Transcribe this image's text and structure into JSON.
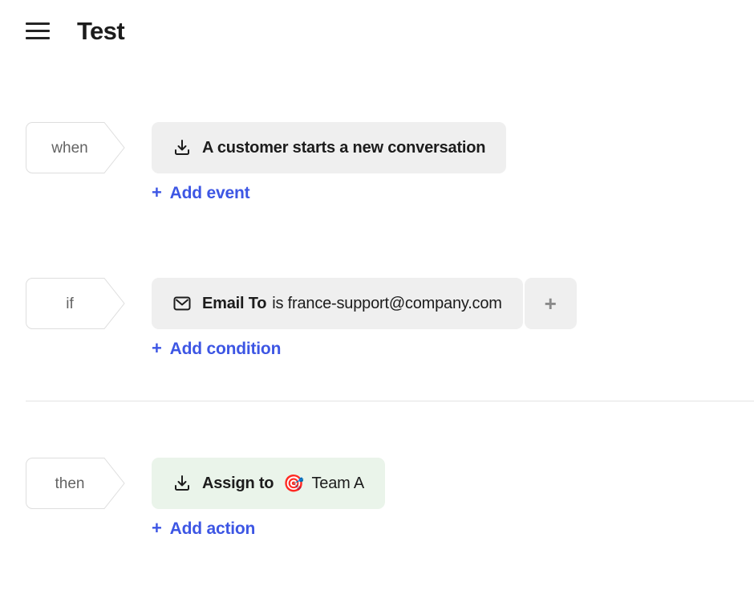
{
  "header": {
    "menu_icon": "hamburger-menu-icon",
    "title": "Test"
  },
  "colors": {
    "accent_blue": "#3d56e4",
    "chip_gray": "#efefef",
    "chip_green": "#eaf4ea",
    "tag_border": "#dedede",
    "divider": "#e3e3e3",
    "text_dark": "#1c1c1c",
    "tag_text": "#636363",
    "plus_gray": "#8a8a8a"
  },
  "workflow": {
    "trigger": {
      "tag": "when",
      "events": [
        {
          "icon": "inbox-download-icon",
          "text": "A customer starts a new conversation"
        }
      ],
      "add_link": {
        "plus": "+",
        "label": "Add event"
      }
    },
    "condition": {
      "tag": "if",
      "conditions": [
        {
          "icon": "envelope-icon",
          "label": "Email To",
          "value": "is france-support@company.com",
          "add_button": "+"
        }
      ],
      "add_link": {
        "plus": "+",
        "label": "Add condition"
      }
    },
    "action": {
      "tag": "then",
      "actions": [
        {
          "icon": "inbox-download-icon",
          "label": "Assign to",
          "emoji": "🎯",
          "value": "Team A"
        }
      ],
      "add_link": {
        "plus": "+",
        "label": "Add action"
      }
    }
  }
}
